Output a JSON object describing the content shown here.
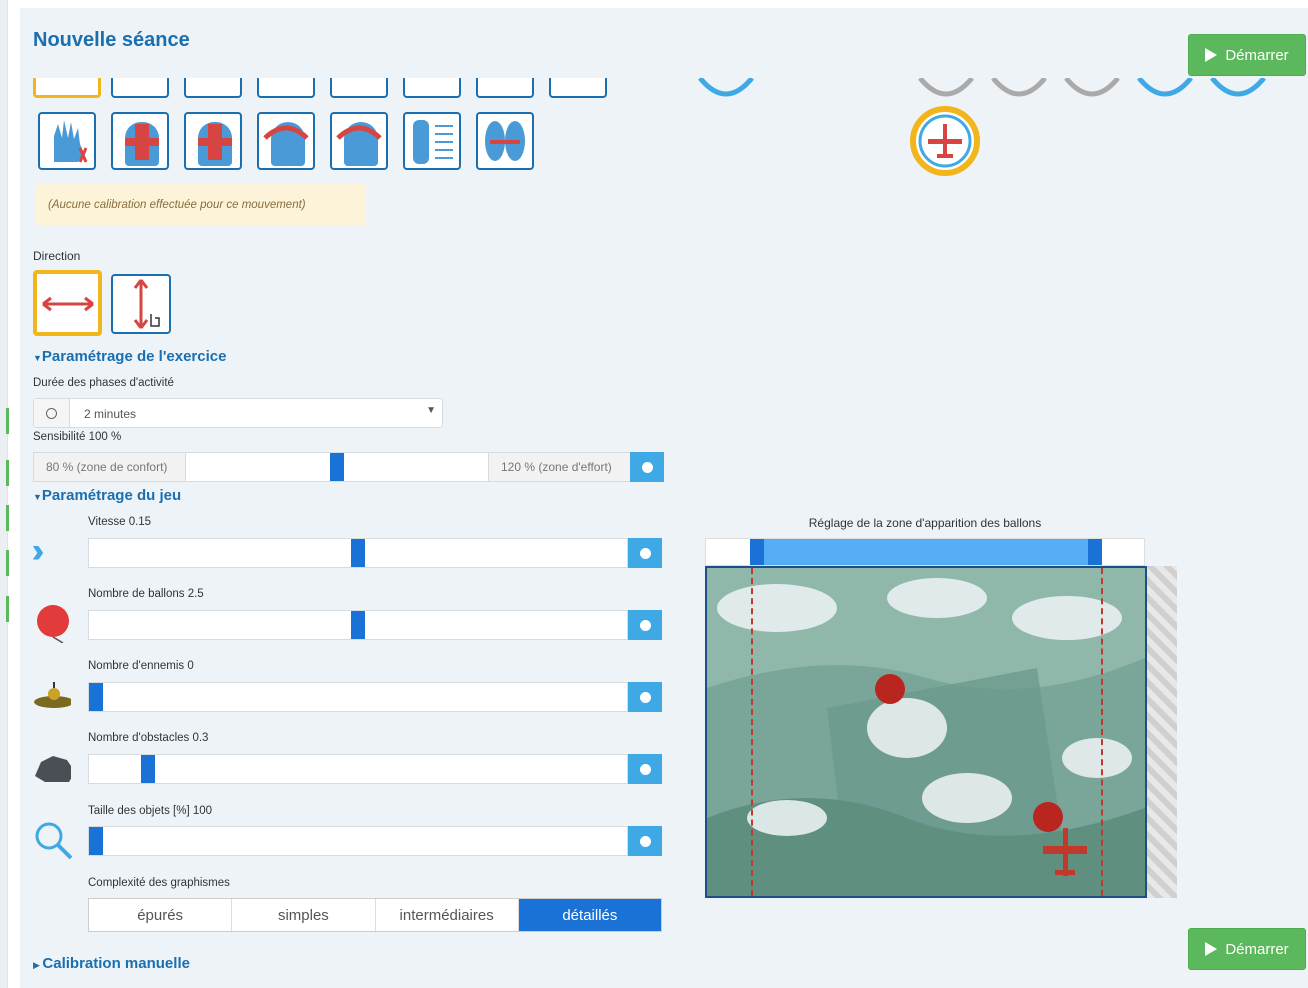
{
  "title": "Nouvelle séance",
  "start_label": "Démarrer",
  "notice": "(Aucune calibration effectuée pour ce mouvement)",
  "direction_label": "Direction",
  "sections": {
    "exercise": "Paramétrage de l'exercice",
    "game": "Paramétrage du jeu",
    "calibration": "Calibration manuelle"
  },
  "duration": {
    "label": "Durée des phases d'activité",
    "value": "2 minutes"
  },
  "sensitivity": {
    "label": "Sensibilité 100 %",
    "left": "80 % (zone de confort)",
    "right": "120 % (zone d'effort)",
    "level": 0.5
  },
  "sliders": [
    {
      "label": "Vitesse 0.15",
      "icon": "speed-arrows-icon",
      "level": 0.5
    },
    {
      "label": "Nombre de ballons 2.5",
      "icon": "balloon-icon",
      "level": 0.5
    },
    {
      "label": "Nombre d'ennemis 0",
      "icon": "enemy-ship-icon",
      "level": 0.0
    },
    {
      "label": "Nombre d'obstacles 0.3",
      "icon": "rock-icon",
      "level": 0.1
    },
    {
      "label": "Taille des objets [%] 100",
      "icon": "magnifier-icon",
      "level": 0.0
    }
  ],
  "complexity": {
    "label": "Complexité des graphismes",
    "options": [
      "épurés",
      "simples",
      "intermédiaires",
      "détaillés"
    ],
    "selected": "détaillés"
  },
  "zone": {
    "title": "Réglage de la zone d'apparition des ballons"
  },
  "colors": {
    "accent": "#1a6fb0",
    "start_green": "#5cb85c",
    "selected_border": "#f2b51b",
    "slider_handle": "#1a72d6",
    "help_button": "#3fa9e6"
  }
}
